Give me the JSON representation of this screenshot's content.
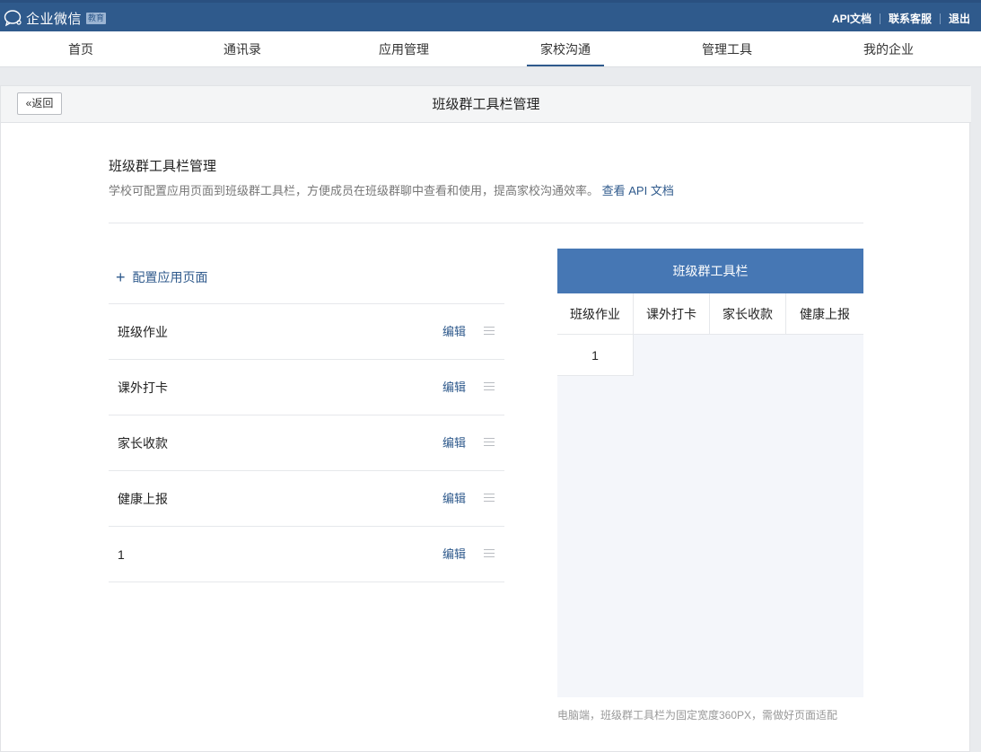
{
  "topbar": {
    "logo_text": "企业微信",
    "badge": "教育",
    "links": [
      "API文档",
      "联系客服",
      "退出"
    ]
  },
  "nav": {
    "items": [
      "首页",
      "通讯录",
      "应用管理",
      "家校沟通",
      "管理工具",
      "我的企业"
    ],
    "active": "家校沟通"
  },
  "header": {
    "back_label": "返回",
    "title": "班级群工具栏管理"
  },
  "section": {
    "title": "班级群工具栏管理",
    "desc": "学校可配置应用页面到班级群工具栏，方便成员在班级群聊中查看和使用，提高家校沟通效率。",
    "link": "查看 API 文档"
  },
  "config": {
    "add_label": "配置应用页面",
    "edit_label": "编辑",
    "rows": [
      "班级作业",
      "课外打卡",
      "家长收款",
      "健康上报",
      "1"
    ]
  },
  "preview": {
    "title": "班级群工具栏",
    "tabs": [
      "班级作业",
      "课外打卡",
      "家长收款",
      "健康上报"
    ],
    "tabs_row2": [
      "1"
    ],
    "note": "电脑端，班级群工具栏为固定宽度360PX，需做好页面适配"
  },
  "colors": {
    "topbar": "#2f5a8c",
    "accent": "#2f5a8c",
    "preview_header": "#4677b4"
  }
}
